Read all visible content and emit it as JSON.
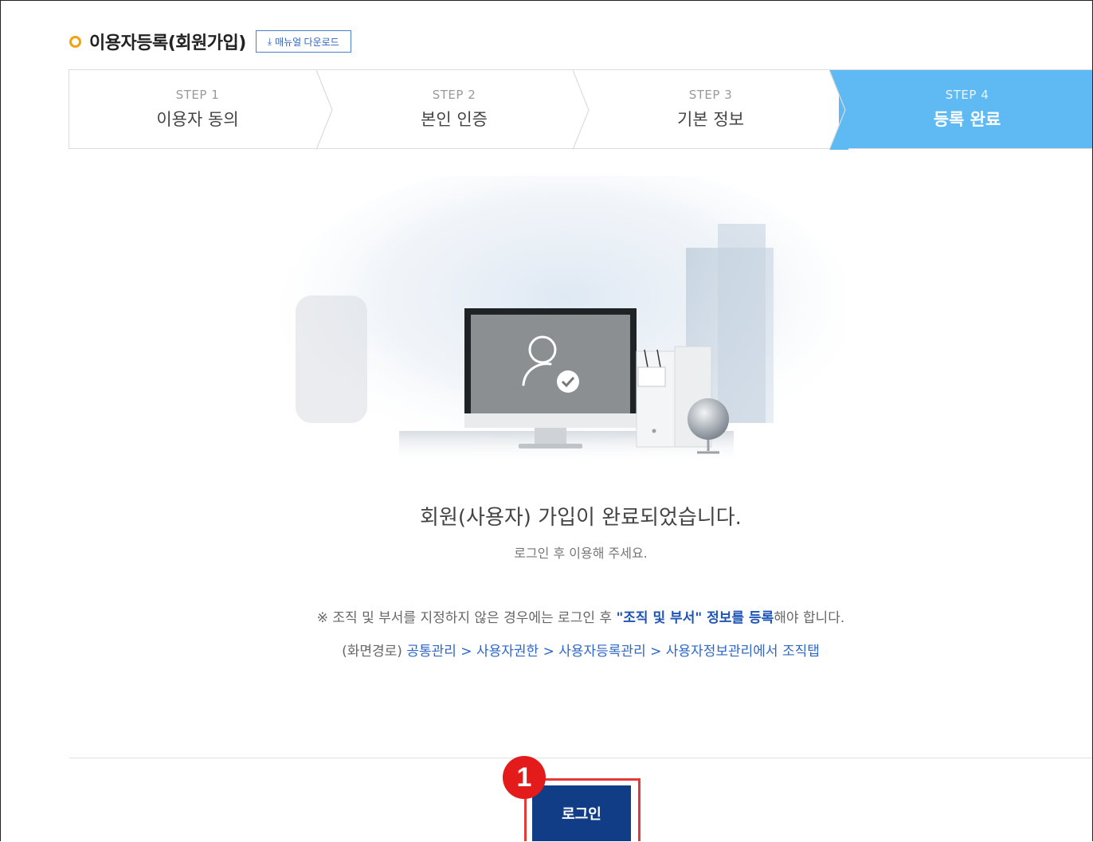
{
  "header": {
    "title": "이용자등록(회원가입)",
    "manual_button": "매뉴얼 다운로드"
  },
  "steps": [
    {
      "step": "STEP 1",
      "title": "이용자 동의",
      "active": false
    },
    {
      "step": "STEP 2",
      "title": "본인 인증",
      "active": false
    },
    {
      "step": "STEP 3",
      "title": "기본 정보",
      "active": false
    },
    {
      "step": "STEP 4",
      "title": "등록 완료",
      "active": true
    }
  ],
  "message": {
    "main": "회원(사용자) 가입이 완료되었습니다.",
    "sub": "로그인 후 이용해 주세요."
  },
  "notice": {
    "prefix": "※ 조직 및 부서를 지정하지 않은 경우에는 로그인 후 ",
    "hl1": "\"조직 및 부서\" 정보를 등록",
    "suffix": "해야 합니다."
  },
  "path": {
    "label": "(화면경로) ",
    "items": [
      "공통관리",
      "사용자권한",
      "사용자등록관리",
      "사용자정보관리에서 조직탭"
    ],
    "sep": " > "
  },
  "login_button": "로그인",
  "annotation_badge": "1",
  "colors": {
    "accent_orange": "#f4a20b",
    "active_step": "#5fb9f3",
    "login_button": "#113c86",
    "annotation_red": "#e31b1b",
    "link_blue": "#2d67c9"
  }
}
